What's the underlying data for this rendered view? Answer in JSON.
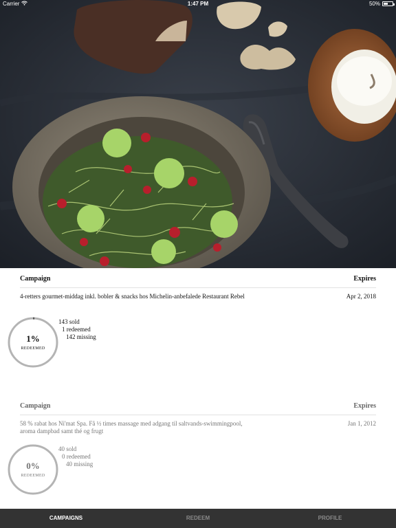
{
  "status_bar": {
    "carrier": "Carrier",
    "time": "1:47 PM",
    "battery": "50%",
    "battery_level": 0.5
  },
  "campaigns": [
    {
      "header_left": "Campaign",
      "header_right": "Expires",
      "description": "4-retters gourmet-middag inkl. bobler & snacks hos Michelin-anbefalede Restaurant Rebel",
      "expires": "Apr 2, 2018",
      "percent_text": "1%",
      "percent_value": 0.01,
      "ring_label": "REDEEMED",
      "sold": "143 sold",
      "redeemed": "1 redeemed",
      "missing": "142 missing"
    },
    {
      "header_left": "Campaign",
      "header_right": "Expires",
      "description": "58 % rabat hos Ni'mat Spa. Få ½ times massage med adgang til saltvands-swimmingpool, aroma dampbad samt thé og frugt",
      "expires": "Jan 1, 2012",
      "percent_text": "0%",
      "percent_value": 0,
      "ring_label": "REDEEMED",
      "sold": "40 sold",
      "redeemed": "0 redeemed",
      "missing": "40 missing"
    }
  ],
  "tabs": [
    {
      "label": "CAMPAIGNS",
      "active": true
    },
    {
      "label": "REDEEM",
      "active": false
    },
    {
      "label": "PROFILE",
      "active": false
    }
  ],
  "colors": {
    "tabbar": "#333333",
    "ring": "#b4b4b4",
    "tab_active": "#ffffff",
    "tab_inactive": "#8a8a8a"
  },
  "icons": {
    "signal": "wifi-icon",
    "battery": "battery-icon"
  }
}
